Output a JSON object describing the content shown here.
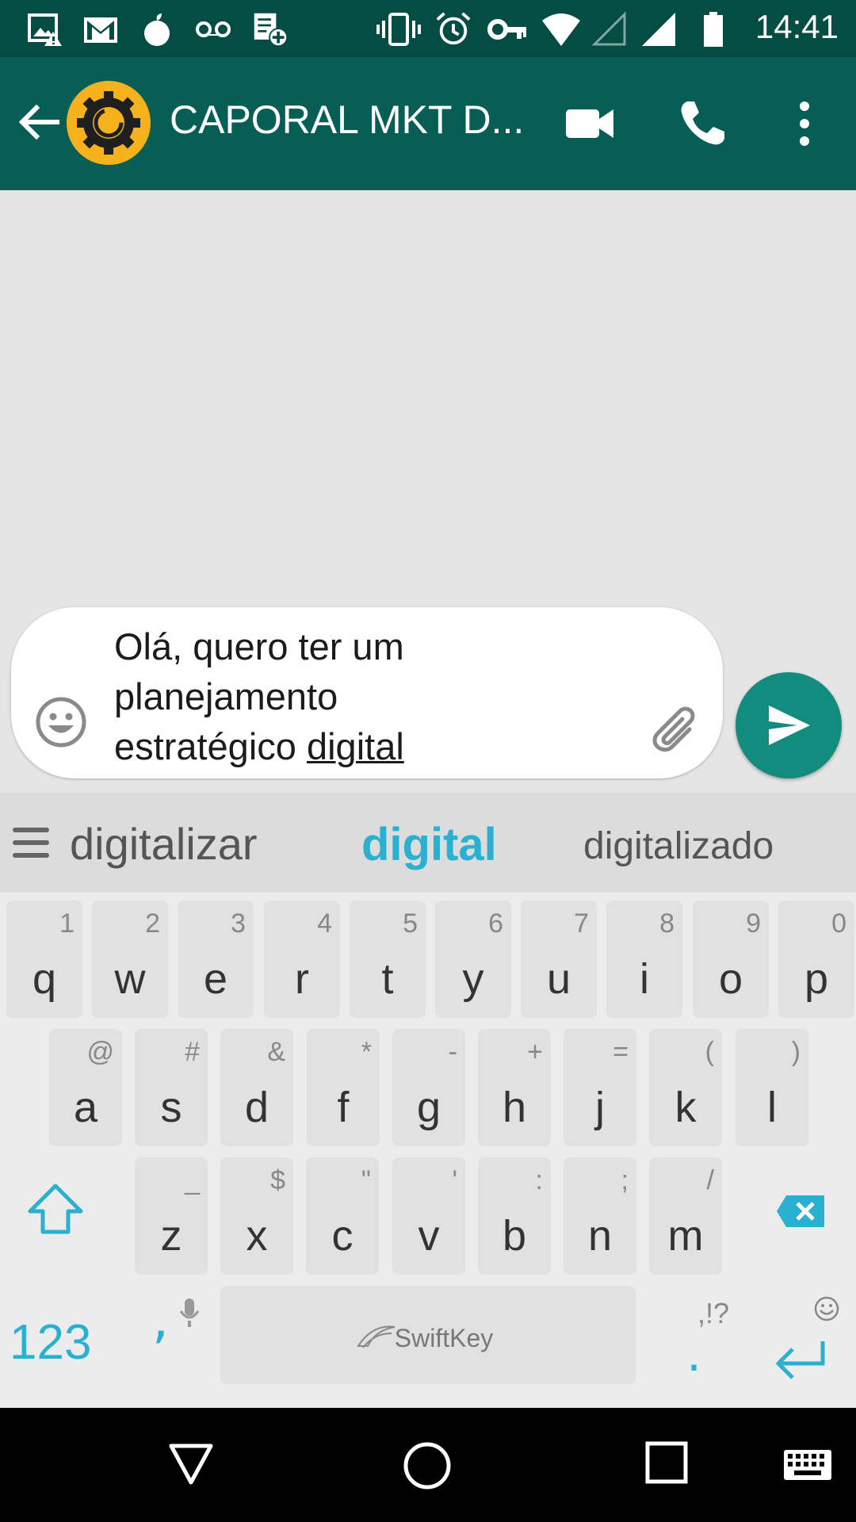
{
  "status_bar": {
    "time": "14:41",
    "left_icons": [
      "image-warning-icon",
      "gmail-icon",
      "fruit-icon",
      "voicemail-icon",
      "checklist-add-icon"
    ],
    "right_icons": [
      "vibrate-icon",
      "alarm-icon",
      "key-icon",
      "wifi-icon",
      "signal-empty-icon",
      "signal-icon",
      "battery-icon"
    ]
  },
  "app_bar": {
    "title": "CAPORAL MKT D...",
    "icons": [
      "back-arrow-icon",
      "video-call-icon",
      "phone-icon",
      "more-vert-icon"
    ],
    "avatar_color": "#f6b21c",
    "bar_color": "#075e54"
  },
  "compose": {
    "text_before": "Olá, quero ter um planejamento estratégico ",
    "text_current_word": "digital",
    "emoji_icon": "emoji-icon",
    "attach_icon": "paperclip-icon",
    "send_icon": "send-icon",
    "send_color": "#128c7e"
  },
  "suggestions": [
    "digitalizar",
    "digital",
    "digitalizado"
  ],
  "keyboard": {
    "row1": [
      {
        "main": "q",
        "sec": "1"
      },
      {
        "main": "w",
        "sec": "2"
      },
      {
        "main": "e",
        "sec": "3"
      },
      {
        "main": "r",
        "sec": "4"
      },
      {
        "main": "t",
        "sec": "5"
      },
      {
        "main": "y",
        "sec": "6"
      },
      {
        "main": "u",
        "sec": "7"
      },
      {
        "main": "i",
        "sec": "8"
      },
      {
        "main": "o",
        "sec": "9"
      },
      {
        "main": "p",
        "sec": "0"
      }
    ],
    "row2": [
      {
        "main": "a",
        "sec": "@"
      },
      {
        "main": "s",
        "sec": "#"
      },
      {
        "main": "d",
        "sec": "&"
      },
      {
        "main": "f",
        "sec": "*"
      },
      {
        "main": "g",
        "sec": "-"
      },
      {
        "main": "h",
        "sec": "+"
      },
      {
        "main": "j",
        "sec": "="
      },
      {
        "main": "k",
        "sec": "("
      },
      {
        "main": "l",
        "sec": ")"
      }
    ],
    "row3": [
      {
        "main": "z",
        "sec": "_"
      },
      {
        "main": "x",
        "sec": "$"
      },
      {
        "main": "c",
        "sec": "\""
      },
      {
        "main": "v",
        "sec": "'"
      },
      {
        "main": "b",
        "sec": ":"
      },
      {
        "main": "n",
        "sec": ";"
      },
      {
        "main": "m",
        "sec": "/"
      }
    ],
    "numbers_label": "123",
    "comma": ",",
    "period": ".",
    "period_secondary": ",!?",
    "space_label": "SwiftKey",
    "accent_color": "#2ab0d0"
  },
  "nav_bar": {
    "icons": [
      "back-triangle-icon",
      "home-circle-icon",
      "recents-square-icon",
      "keyboard-icon"
    ]
  }
}
